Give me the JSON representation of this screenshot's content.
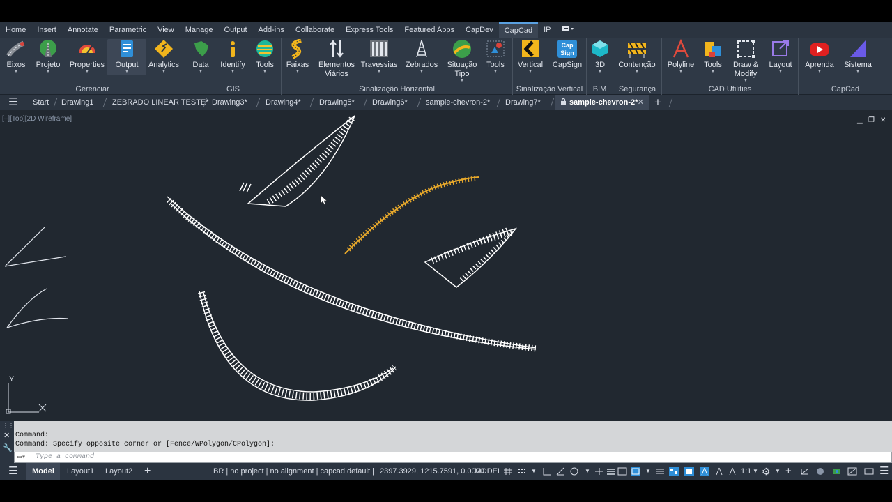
{
  "menu": [
    "Home",
    "Insert",
    "Annotate",
    "Parametric",
    "View",
    "Manage",
    "Output",
    "Add-ins",
    "Collaborate",
    "Express Tools",
    "Featured Apps",
    "CapDev",
    "CapCad",
    "IP"
  ],
  "menu_active": "CapCad",
  "ribbon": {
    "panels": {
      "gerenciar": "Gerenciar",
      "gis": "GIS",
      "sinal_h": "Sinalização Horizontal",
      "sinal_v": "Sinalização Vertical",
      "bim": "BIM",
      "seguranca": "Segurança",
      "cad_utilities": "CAD Utilities",
      "capcad": "CapCad"
    },
    "tools": {
      "eixos": "Eixos",
      "projeto": "Projeto",
      "properties": "Properties",
      "output": "Output",
      "analytics": "Analytics",
      "data": "Data",
      "identify": "Identify",
      "tools_gis": "Tools",
      "faixas": "Faixas",
      "elementos_1": "Elementos",
      "elementos_2": "Viários",
      "travessias": "Travessias",
      "zebrados": "Zebrados",
      "situacao_1": "Situação",
      "situacao_2": "Tipo",
      "tools_sh": "Tools",
      "vertical": "Vertical",
      "capsign": "CapSign",
      "capsign_icon_1": "Cap",
      "capsign_icon_2": "Sign",
      "bim3d": "3D",
      "contencao": "Contenção",
      "polyline": "Polyline",
      "tools_cad": "Tools",
      "draw_1": "Draw &",
      "draw_2": "Modify",
      "layout": "Layout",
      "aprenda": "Aprenda",
      "sistema": "Sistema"
    }
  },
  "tabs": {
    "start": "Start",
    "t1": "Drawing1",
    "t2": "ZEBRADO LINEAR TESTE*",
    "t3": "Drawing3*",
    "t4": "Drawing4*",
    "t5": "Drawing5*",
    "t6": "Drawing6*",
    "t7": "sample-chevron-2*",
    "t8": "Drawing7*",
    "active": "sample-chevron-2*"
  },
  "viewport": {
    "label": "[–][Top][2D Wireframe]",
    "ucs_y": "Y",
    "ucs_x": "X"
  },
  "command": {
    "line1": "Command:",
    "line2": "Command: Specify opposite corner or [Fence/WPolygon/CPolygon]:",
    "placeholder": "Type a command"
  },
  "status": {
    "model_tab": "Model",
    "layout1": "Layout1",
    "layout2": "Layout2",
    "info": "BR | no project | no alignment | capcad.default |",
    "coords": "2397.3929, 1215.7591, 0.0000",
    "mode": "MODEL",
    "scale": "1:1"
  },
  "colors": {
    "viewport_bg": "#212830",
    "ribbon_bg": "#2f3946",
    "selected_hatch": "#e8a92b",
    "hatch": "#ffffff"
  }
}
